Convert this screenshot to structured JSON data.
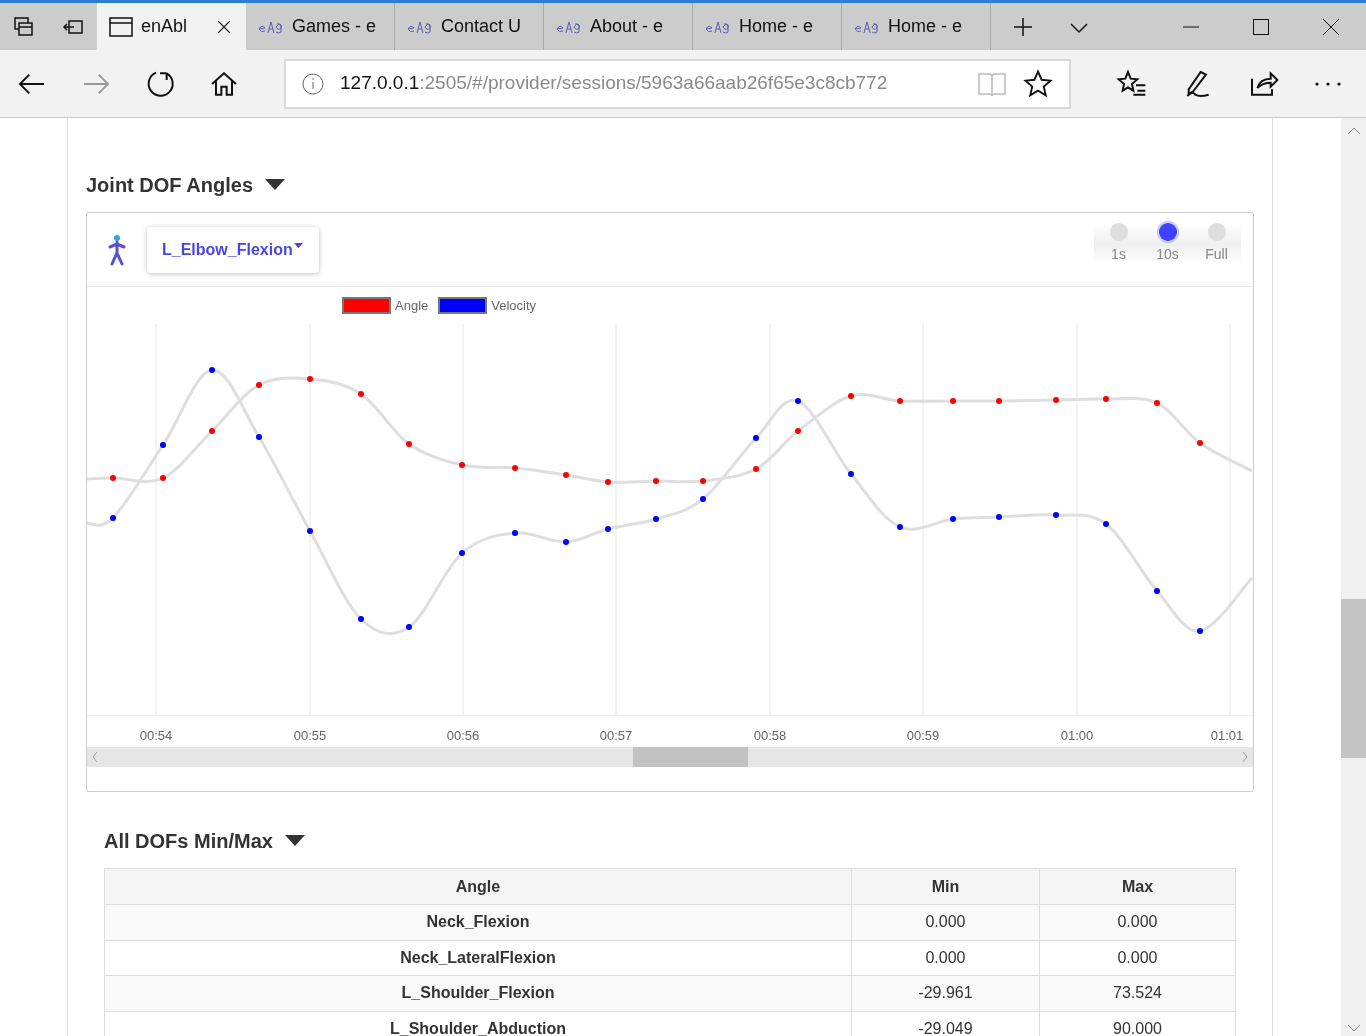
{
  "browser": {
    "tabs": [
      {
        "label": "enAbl",
        "selected": true
      },
      {
        "label": "Games - e",
        "selected": false
      },
      {
        "label": "Contact U",
        "selected": false
      },
      {
        "label": "About - e",
        "selected": false
      },
      {
        "label": "Home - e",
        "selected": false
      },
      {
        "label": "Home - e",
        "selected": false
      }
    ],
    "address": {
      "host": "127.0.0.1",
      "path": ":2505/#/provider/sessions/5963a66aab26f65e3c8cb772"
    }
  },
  "joint_section": {
    "title": "Joint DOF Angles",
    "dof_dropdown": "L_Elbow_Flexion",
    "range_options": [
      {
        "label": "1s",
        "selected": false
      },
      {
        "label": "10s",
        "selected": true
      },
      {
        "label": "Full",
        "selected": false
      }
    ],
    "legend": [
      {
        "label": "Angle",
        "color": "#ff0000"
      },
      {
        "label": "Velocity",
        "color": "#0000ff"
      }
    ],
    "x_ticks": [
      "00:54",
      "00:55",
      "00:56",
      "00:57",
      "00:58",
      "00:59",
      "01:00",
      "01:01"
    ]
  },
  "minmax_section": {
    "title": "All DOFs Min/Max",
    "columns": [
      "Angle",
      "Min",
      "Max"
    ],
    "rows": [
      [
        "Neck_Flexion",
        "0.000",
        "0.000"
      ],
      [
        "Neck_LateralFlexion",
        "0.000",
        "0.000"
      ],
      [
        "L_Shoulder_Flexion",
        "-29.961",
        "73.524"
      ],
      [
        "L_Shoulder_Abduction",
        "-29.049",
        "90.000"
      ]
    ]
  }
}
